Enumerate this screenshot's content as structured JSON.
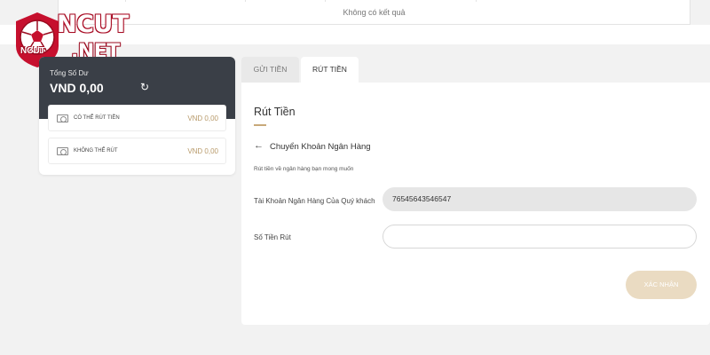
{
  "history": {
    "empty_text": "Không có kết quả"
  },
  "logo": {
    "brand_main": "NCUT",
    "brand_suffix": ".NET",
    "badge_text": "NCUT"
  },
  "balance": {
    "label": "Tổng Số Dư",
    "amount": "VND 0,00",
    "rows": [
      {
        "label": "CÓ THỂ RÚT TIỀN",
        "value": "VND 0,00"
      },
      {
        "label": "KHÔNG THỂ RÚT",
        "value": "VND 0,00"
      }
    ]
  },
  "tabs": {
    "deposit": "GỬI TIỀN",
    "withdraw": "RÚT TIỀN",
    "active": "withdraw"
  },
  "withdraw": {
    "title": "Rút Tiền",
    "method": "Chuyển Khoản Ngân Hàng",
    "hint": "Rút tiền về ngân hàng bạn mong muốn",
    "account_label": "Tài Khoản Ngân Hàng Của Quý khách",
    "account_value": "76545643546547",
    "amount_label": "Số Tiền Rút",
    "amount_value": "",
    "confirm_label": "XÁC NHẬN"
  },
  "colors": {
    "accent_gold": "#c8a97a",
    "header_dark": "#3a3f47",
    "button_disabled": "#eadbc2",
    "logo_red": "#c6102e"
  },
  "icons": {
    "back": "arrow-left-icon",
    "refresh": "refresh-icon",
    "money": "cash-icon",
    "logo": "soccer-ball-icon"
  }
}
